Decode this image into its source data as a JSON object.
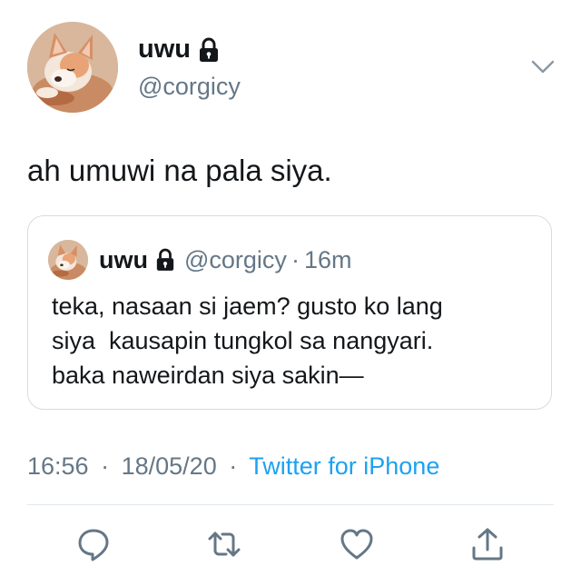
{
  "author": {
    "display_name": "uwu",
    "handle": "@corgicy",
    "avatar_icon": "corgi-avatar",
    "protected_icon": "lock-icon"
  },
  "tweet": {
    "text": "ah umuwi na pala siya."
  },
  "quoted_tweet": {
    "display_name": "uwu",
    "handle": "@corgicy",
    "separator": "·",
    "time": "16m",
    "text": "teka, nasaan si jaem? gusto ko lang\nsiya  kausapin tungkol sa nangyari.\nbaka naweirdan siya sakin—"
  },
  "meta": {
    "time": "16:56",
    "sep1": "·",
    "date": "18/05/20",
    "sep2": "·",
    "source": "Twitter for iPhone"
  },
  "actions": {
    "reply_icon": "reply-icon",
    "retweet_icon": "retweet-icon",
    "like_icon": "heart-icon",
    "share_icon": "share-icon"
  },
  "colors": {
    "text": "#14171a",
    "secondary": "#657786",
    "link": "#1da1f2",
    "border": "#d5dce1"
  }
}
